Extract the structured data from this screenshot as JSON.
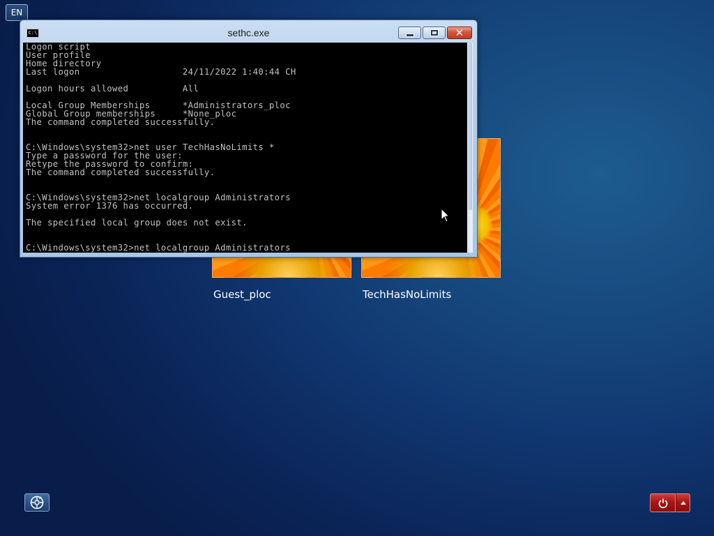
{
  "language": "EN",
  "users": [
    {
      "name": "Guest_ploc"
    },
    {
      "name": "TechHasNoLimits"
    }
  ],
  "console_window": {
    "title": "sethc.exe",
    "icon_text": "C:\\",
    "lines": [
      "Logon script",
      "User profile",
      "Home directory",
      "Last logon                   24/11/2022 1:40:44 CH",
      "",
      "Logon hours allowed          All",
      "",
      "Local Group Memberships      *Administrators_ploc",
      "Global Group memberships     *None_ploc",
      "The command completed successfully.",
      "",
      "",
      "C:\\Windows\\system32>net user TechHasNoLimits *",
      "Type a password for the user:",
      "Retype the password to confirm:",
      "The command completed successfully.",
      "",
      "",
      "C:\\Windows\\system32>net localgroup Administrators",
      "System error 1376 has occurred.",
      "",
      "The specified local group does not exist.",
      "",
      "",
      "C:\\Windows\\system32>net localgroup Administrators"
    ],
    "close_glyph": "✕"
  },
  "icons": {
    "ease_of_access": "ease-of-access-icon",
    "power": "power-icon",
    "power_options": "chevron-up-icon"
  }
}
